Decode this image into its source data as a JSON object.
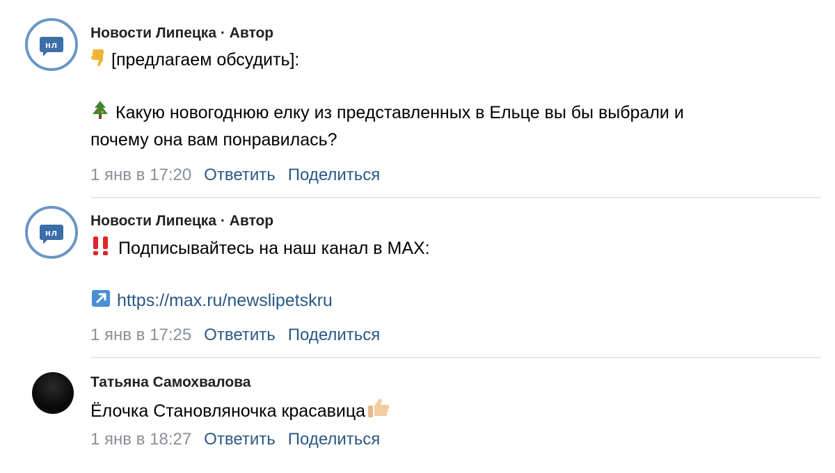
{
  "top_fragment": "‿",
  "comments": [
    {
      "author": "Новости Липецка · Автор",
      "avatar_text": "нл",
      "line1": "[предлагаем обсудить]:",
      "line2": "Какую новогоднюю елку из представленных в Ельце вы бы выбрали и",
      "line3": "почему она вам понравилась?",
      "time": "1 янв в 17:20",
      "reply": "Ответить",
      "share": "Поделиться"
    },
    {
      "author": "Новости Липецка · Автор",
      "avatar_text": "нл",
      "line1": "Подписывайтесь на наш канал в MAX:",
      "link": "https://max.ru/newslipetskru",
      "time": "1 янв в 17:25",
      "reply": "Ответить",
      "share": "Поделиться"
    },
    {
      "author": "Татьяна Самохвалова",
      "line1": "Ёлочка Становляночка красавица",
      "time": "1 янв в 18:27",
      "reply": "Ответить",
      "share": "Поделиться"
    }
  ],
  "icons": {
    "c1_line1": "pointing-down-icon",
    "c1_line2": "christmas-tree-icon",
    "c2_line1": "double-exclamation-icon",
    "c2_link": "arrow-up-right-icon",
    "c3_line1": "thumbs-up-icon"
  },
  "colors": {
    "link": "#2a5885",
    "meta": "#8a8f96",
    "avatar_ring": "#6a96c4",
    "logo": "#3c6ea8"
  }
}
